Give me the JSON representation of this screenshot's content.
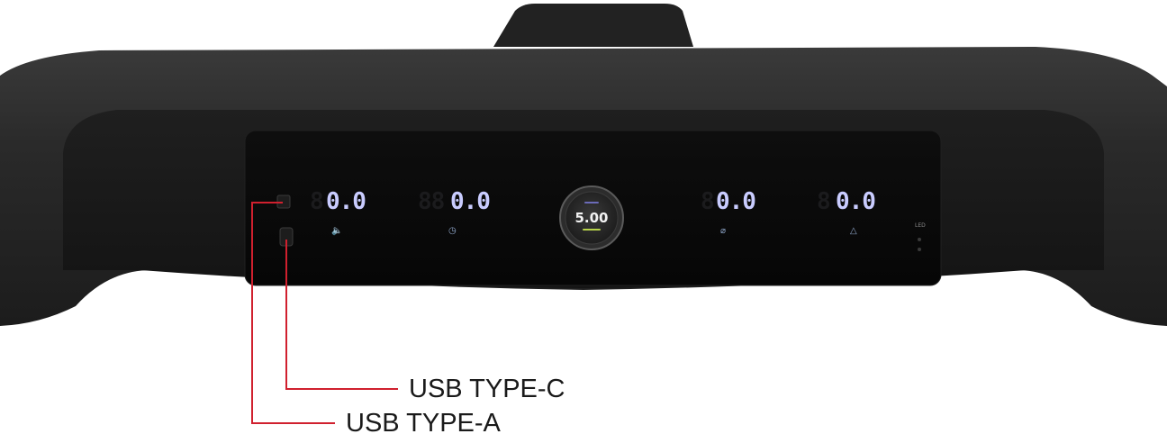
{
  "console": {
    "knob": {
      "value": "5.00"
    },
    "displays": [
      {
        "value": "0.0",
        "icon": "speaker-icon"
      },
      {
        "value": "0.0",
        "icon": "clock-icon"
      },
      {
        "value": "0.0",
        "icon": "incline-icon"
      },
      {
        "value": "0.0",
        "icon": "calorie-icon"
      }
    ],
    "led_label": "LED"
  },
  "callouts": {
    "usb_c": "USB TYPE-C",
    "usb_a": "USB TYPE-A"
  },
  "colors": {
    "callout_line": "#d0202e",
    "digit": "#c9ccff",
    "console_body": "#262626",
    "display_panel": "#0a0a0a",
    "knob_accent": "#b7d34a"
  }
}
